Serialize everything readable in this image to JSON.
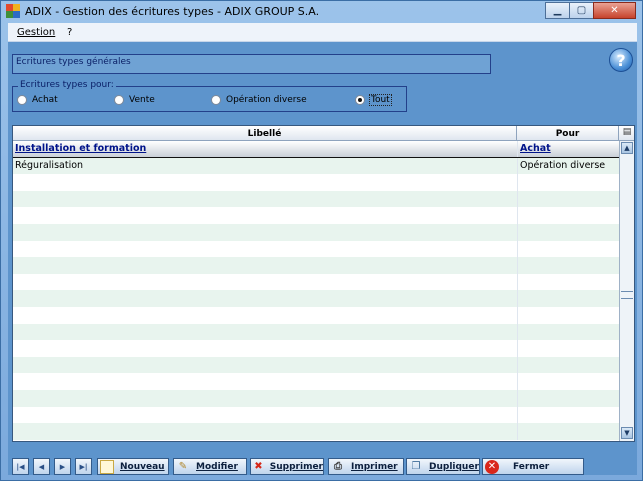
{
  "window": {
    "title": "ADIX - Gestion des écritures types - ADIX GROUP S.A.",
    "buttons": {
      "minimize": "▁",
      "maximize": "▢",
      "close": "✕"
    }
  },
  "menu": [
    {
      "label": "Gestion"
    },
    {
      "label": "?"
    }
  ],
  "header": {
    "title": "Ecritures types générales"
  },
  "help": {
    "icon": "help-icon",
    "glyph": "?"
  },
  "filter": {
    "legend": "Ecritures types pour:",
    "options": [
      {
        "label": "Achat",
        "checked": false
      },
      {
        "label": "Vente",
        "checked": false
      },
      {
        "label": "Opération diverse",
        "checked": false
      },
      {
        "label": "Tout",
        "checked": true
      }
    ]
  },
  "grid": {
    "columns": [
      {
        "label": "Libellé"
      },
      {
        "label": "Pour"
      }
    ],
    "corner_icon": "table-settings-icon",
    "rows": [
      {
        "libelle": "Installation et formation",
        "pour": "Achat",
        "selected": true
      },
      {
        "libelle": "Réguralisation",
        "pour": "Opération diverse",
        "selected": false
      }
    ]
  },
  "toolbar": {
    "nav": {
      "first": "|◀",
      "prev": "◀",
      "next": "▶",
      "last": "▶|"
    },
    "buttons": [
      {
        "label": "Nouveau",
        "icon": "new-document-icon"
      },
      {
        "label": "Modifier",
        "icon": "pencil-icon"
      },
      {
        "label": "Supprimer",
        "icon": "delete-x-icon"
      },
      {
        "label": "Imprimer",
        "icon": "printer-icon"
      },
      {
        "label": "Dupliquer",
        "icon": "duplicate-icon"
      },
      {
        "label": "Fermer",
        "icon": "close-circle-icon"
      }
    ]
  },
  "colors": {
    "accent": "#5d94cc",
    "selection_text": "#00138a",
    "alt_row": "#e8f4ee"
  }
}
